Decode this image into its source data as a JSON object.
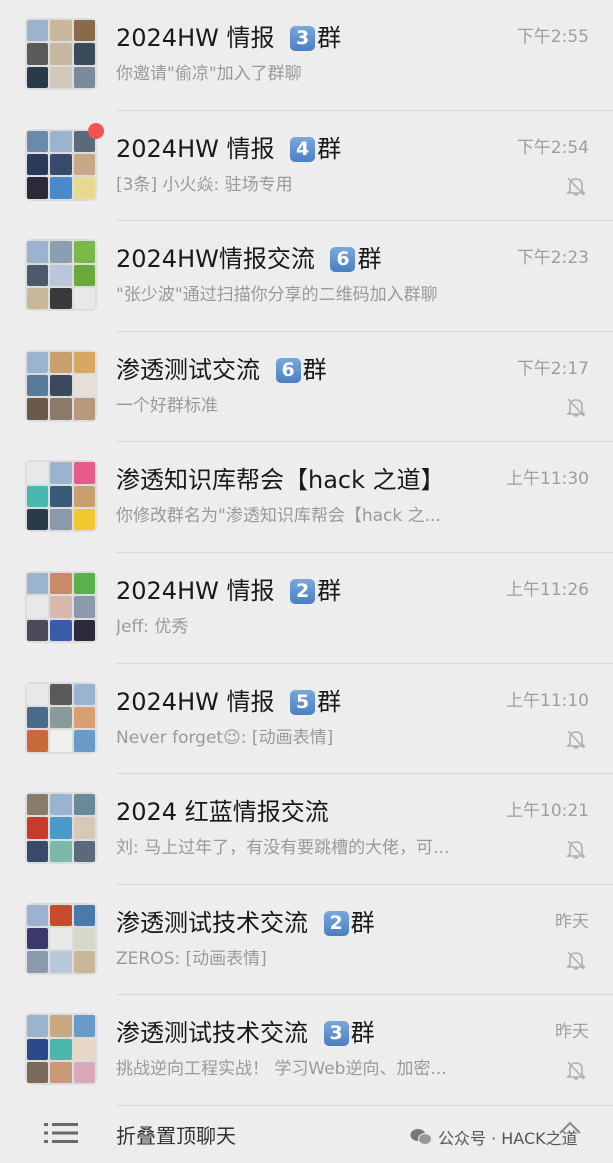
{
  "chats": [
    {
      "name_before": "2024HW 情报 ",
      "badge": "3",
      "name_after": "群",
      "time": "下午2:55",
      "preview": "你邀请\"偷凉\"加入了群聊",
      "muted": false,
      "unread_dot": false,
      "tiles": [
        "#9ab4cf",
        "#c9b89a",
        "#8a6a4a",
        "#5a5a5a",
        "#c8b8a0",
        "#3a4a5a",
        "#2a3a4a",
        "#d0c8b8",
        "#7a8a9a"
      ]
    },
    {
      "name_before": "2024HW 情报 ",
      "badge": "4",
      "name_after": "群",
      "time": "下午2:54",
      "preview": "[3条] 小火焱: 驻场专用",
      "muted": true,
      "unread_dot": true,
      "tiles": [
        "#6a8aaa",
        "#9ab4cf",
        "#5a6a7a",
        "#2a3a5a",
        "#3a4a6a",
        "#c8a888",
        "#2a2a3a",
        "#4a8aca",
        "#e8d890"
      ]
    },
    {
      "name_before": "2024HW情报交流 ",
      "badge": "6",
      "name_after": "群",
      "time": "下午2:23",
      "preview": "\"张少波\"通过扫描你分享的二维码加入群聊",
      "muted": false,
      "unread_dot": false,
      "tiles": [
        "#9ab4cf",
        "#8aa0b0",
        "#7ab84a",
        "#4a5a6a",
        "#b8c8d8",
        "#6aaa3a",
        "#c8b898",
        "#3a3a3a",
        "#e8e8e8"
      ]
    },
    {
      "name_before": "渗透测试交流 ",
      "badge": "6",
      "name_after": "群",
      "time": "下午2:17",
      "preview": "一个好群标准",
      "muted": true,
      "unread_dot": false,
      "tiles": [
        "#9ab4cf",
        "#c8a070",
        "#d8a860",
        "#5a7a9a",
        "#3a4a5a",
        "#e8e0d8",
        "#6a5a4a",
        "#8a7a6a",
        "#b89878"
      ]
    },
    {
      "name_before": "渗透知识库帮会【hack 之道】",
      "badge": "",
      "name_after": "",
      "time": "上午11:30",
      "preview": "你修改群名为\"渗透知识库帮会【hack 之...",
      "muted": false,
      "unread_dot": false,
      "tiles": [
        "#e8e8e8",
        "#9ab4cf",
        "#e85a8a",
        "#4ab8b0",
        "#3a5a7a",
        "#c8a070",
        "#2a3a4a",
        "#8a9aaa",
        "#f0c830"
      ]
    },
    {
      "name_before": "2024HW 情报 ",
      "badge": "2",
      "name_after": "群",
      "time": "上午11:26",
      "preview": "Jeff:  优秀",
      "muted": false,
      "unread_dot": false,
      "tiles": [
        "#9ab4cf",
        "#c88a6a",
        "#5ab04a",
        "#e8e8e8",
        "#d8b8a8",
        "#8a9aaa",
        "#4a4a5a",
        "#3a5aaa",
        "#2a2a3a"
      ]
    },
    {
      "name_before": "2024HW 情报 ",
      "badge": "5",
      "name_after": "群",
      "time": "上午11:10",
      "preview": "Never forget😉: [动画表情]",
      "muted": true,
      "unread_dot": false,
      "tiles": [
        "#e8e8e8",
        "#5a5a5a",
        "#9ab4cf",
        "#4a6a8a",
        "#8a9a9a",
        "#d8a070",
        "#c86a3a",
        "#f0f0f0",
        "#6a9ac8"
      ]
    },
    {
      "name_before": "2024 红蓝情报交流",
      "badge": "",
      "name_after": "",
      "time": "上午10:21",
      "preview": "刘: 马上过年了，有没有要跳槽的大佬，可...",
      "muted": true,
      "unread_dot": false,
      "tiles": [
        "#8a7a6a",
        "#9ab4cf",
        "#6a8a9a",
        "#c83a2a",
        "#4a9ac8",
        "#d8c8b8",
        "#3a4a6a",
        "#7ab8a8",
        "#5a6a7a"
      ]
    },
    {
      "name_before": "渗透测试技术交流 ",
      "badge": "2",
      "name_after": "群",
      "time": "昨天",
      "preview": "ZEROS: [动画表情]",
      "muted": true,
      "unread_dot": false,
      "tiles": [
        "#9ab4cf",
        "#c84a2a",
        "#4a7aaa",
        "#3a3a6a",
        "#e8e8e8",
        "#d8d8c8",
        "#8a9aaa",
        "#b8c8d8",
        "#c8b898"
      ]
    },
    {
      "name_before": "渗透测试技术交流 ",
      "badge": "3",
      "name_after": "群",
      "time": "昨天",
      "preview": "挑战逆向工程实战！ 学习Web逆向、加密...",
      "muted": true,
      "unread_dot": false,
      "tiles": [
        "#9ab4cf",
        "#c8a880",
        "#6a9ac8",
        "#2a4a8a",
        "#4ab8a8",
        "#e8d8c8",
        "#7a6a5a",
        "#c89878",
        "#d8a8b8"
      ]
    }
  ],
  "bottom": {
    "fold_label": "折叠置顶聊天",
    "watermark": "公众号 · HACK之道"
  },
  "colors": {
    "background": "#ededed",
    "badge": "#4a7fc2",
    "unread_dot": "#f25454",
    "text_primary": "#191919",
    "text_secondary": "#9a9a9a"
  },
  "icons": {
    "mute": "bell-off-icon",
    "fold": "list-icon",
    "wechat": "wechat-icon",
    "chevron": "chevron-up-icon"
  }
}
